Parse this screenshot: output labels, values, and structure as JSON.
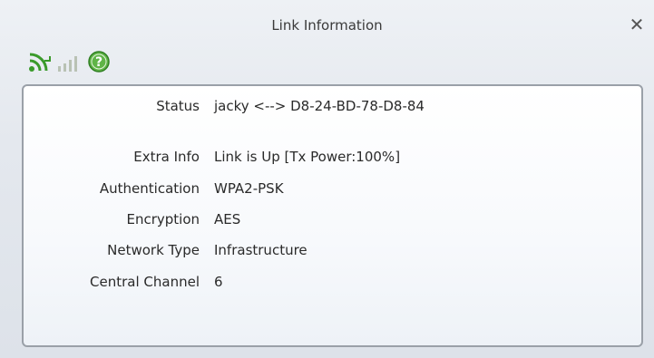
{
  "window": {
    "title": "Link Information",
    "close_glyph": "✕"
  },
  "toolbar": {
    "icons": [
      "link-status-icon",
      "signal-strength-icon",
      "help-icon"
    ],
    "colors": {
      "green": "#3a9a2a",
      "grey": "#b9c2b4"
    }
  },
  "info": {
    "rows": [
      {
        "label": "Status",
        "value": "jacky <--> D8-24-BD-78-D8-84"
      },
      {
        "label": "Extra Info",
        "value": "Link is Up  [Tx Power:100%]"
      },
      {
        "label": "Authentication",
        "value": "WPA2-PSK"
      },
      {
        "label": "Encryption",
        "value": "AES"
      },
      {
        "label": "Network Type",
        "value": "Infrastructure"
      },
      {
        "label": "Central Channel",
        "value": "6"
      }
    ]
  }
}
